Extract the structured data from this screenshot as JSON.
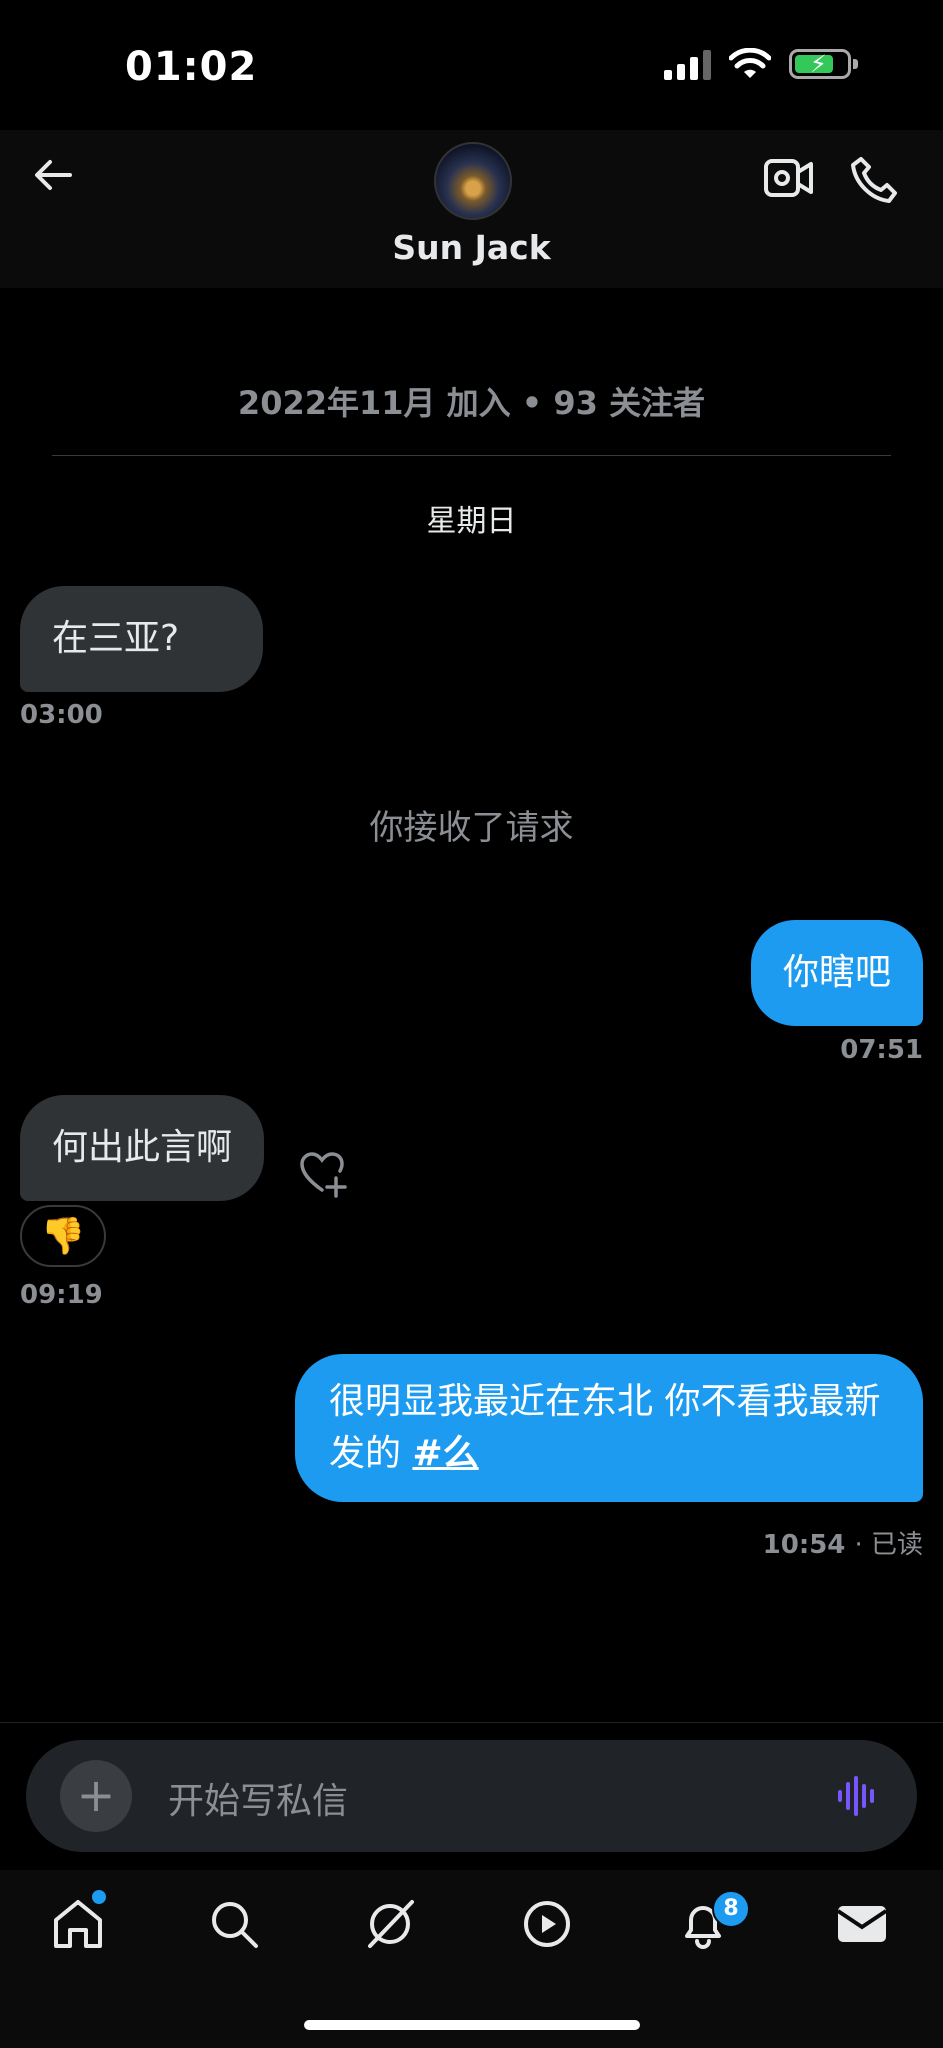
{
  "status_bar": {
    "time": "01:02"
  },
  "header": {
    "name": "Sun Jack",
    "joined": "2022年11月 加入 • 93 关注者"
  },
  "day_separator": "星期日",
  "messages": [
    {
      "text": "在三亚?",
      "time": "03:00"
    },
    {
      "text": "你接收了请求"
    },
    {
      "text": "你瞎吧",
      "time": "07:51"
    },
    {
      "text": "何出此言啊",
      "time": "09:19",
      "reaction": "👎"
    },
    {
      "text_before": "很明显我最近在东北 你不看我最新发的 ",
      "hashtag": "#么",
      "time": "10:54",
      "status": "· 已读"
    }
  ],
  "composer": {
    "placeholder": "开始写私信"
  },
  "tabbar": {
    "notification_count": "8"
  },
  "colors": {
    "accent": "#1d9bf0",
    "incoming": "#2f3336",
    "voice": "#7856ff"
  }
}
